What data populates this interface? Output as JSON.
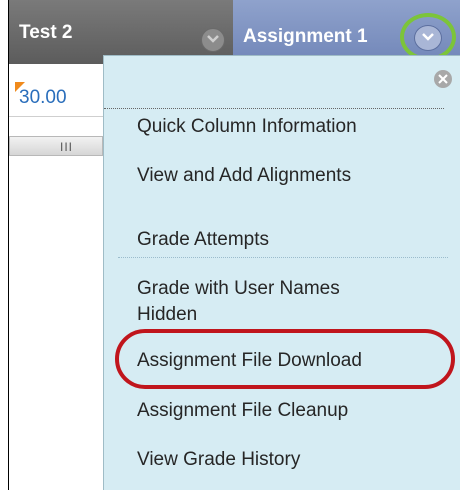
{
  "columns": {
    "test2": {
      "label": "Test 2"
    },
    "assignment1": {
      "label": "Assignment 1"
    }
  },
  "grade_cell": {
    "value": "30.00"
  },
  "scroll": {
    "grip": "III"
  },
  "menu": {
    "items": [
      "Quick Column Information",
      "View and Add Alignments",
      "Grade Attempts",
      "Grade with User Names",
      "Hidden",
      "Assignment File Download",
      "Assignment File Cleanup",
      "View Grade History"
    ]
  },
  "highlight": {
    "green_ring_color": "#7cc43a",
    "red_ring_color": "#c0151c"
  }
}
